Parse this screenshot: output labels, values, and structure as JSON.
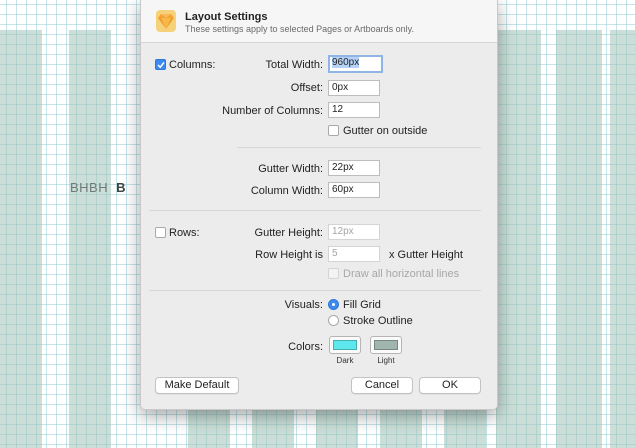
{
  "artboard": {
    "text_light": "BHBH",
    "text_bold": "B"
  },
  "dialog": {
    "icon": "sketch-diamond-icon",
    "title": "Layout Settings",
    "subtitle": "These settings apply to selected Pages or Artboards only."
  },
  "columns": {
    "checkbox_label": "Columns:",
    "checked": true,
    "total_width_label": "Total Width:",
    "total_width_value": "960px",
    "offset_label": "Offset:",
    "offset_value": "0px",
    "num_columns_label": "Number of Columns:",
    "num_columns_value": "12",
    "gutter_outside_label": "Gutter on outside",
    "gutter_outside_checked": false,
    "gutter_width_label": "Gutter Width:",
    "gutter_width_value": "22px",
    "column_width_label": "Column Width:",
    "column_width_value": "60px"
  },
  "rows": {
    "checkbox_label": "Rows:",
    "checked": false,
    "gutter_height_label": "Gutter Height:",
    "gutter_height_value": "12px",
    "row_height_label": "Row Height is",
    "row_height_value": "5",
    "row_height_suffix": "x Gutter Height",
    "draw_lines_label": "Draw all horizontal lines",
    "draw_lines_checked": false
  },
  "visuals": {
    "label": "Visuals:",
    "options": [
      "Fill Grid",
      "Stroke Outline"
    ],
    "selected": "Fill Grid"
  },
  "colors": {
    "label": "Colors:",
    "dark_label": "Dark",
    "light_label": "Light",
    "dark_color": "#5ee8ee",
    "light_color": "#9fb5ae"
  },
  "buttons": {
    "make_default": "Make Default",
    "cancel": "Cancel",
    "ok": "OK"
  }
}
